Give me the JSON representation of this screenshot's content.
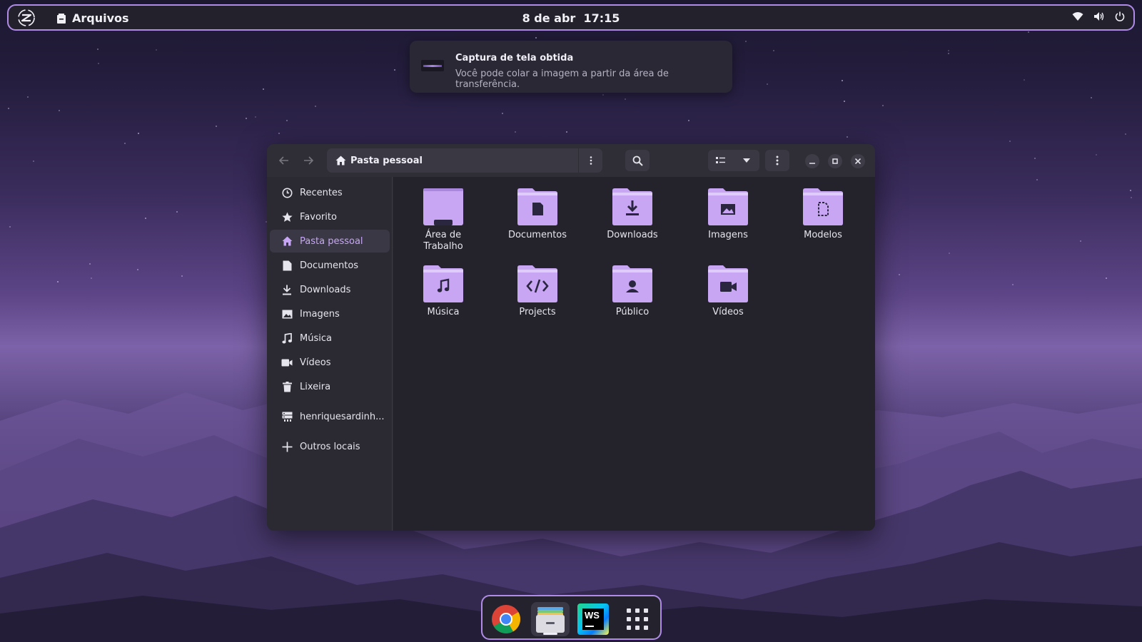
{
  "topbar": {
    "app_name": "Arquivos",
    "clock": "8 de abr  17:15",
    "icons": [
      "zorin-menu-icon",
      "wifi-icon",
      "volume-icon",
      "power-icon"
    ]
  },
  "notification": {
    "title": "Captura de tela obtida",
    "body": "Você pode colar a imagem a partir da área de transferência."
  },
  "window": {
    "path_label": "Pasta pessoal",
    "sidebar": [
      {
        "label": "Recentes",
        "icon": "clock-icon"
      },
      {
        "label": "Favorito",
        "icon": "star-icon"
      },
      {
        "label": "Pasta pessoal",
        "icon": "home-icon",
        "active": true
      },
      {
        "label": "Documentos",
        "icon": "document-icon"
      },
      {
        "label": "Downloads",
        "icon": "download-icon"
      },
      {
        "label": "Imagens",
        "icon": "image-icon"
      },
      {
        "label": "Música",
        "icon": "music-icon"
      },
      {
        "label": "Vídeos",
        "icon": "video-icon"
      },
      {
        "label": "Lixeira",
        "icon": "trash-icon"
      },
      {
        "label": "henriquesardinh...",
        "icon": "network-drive-icon"
      },
      {
        "label": "Outros locais",
        "icon": "plus-icon"
      }
    ],
    "files": [
      {
        "name": "Área de\nTrabalho",
        "icon": "desktop-folder-icon"
      },
      {
        "name": "Documentos",
        "icon": "documents-folder-icon"
      },
      {
        "name": "Downloads",
        "icon": "downloads-folder-icon"
      },
      {
        "name": "Imagens",
        "icon": "pictures-folder-icon"
      },
      {
        "name": "Modelos",
        "icon": "templates-folder-icon"
      },
      {
        "name": "Música",
        "icon": "music-folder-icon"
      },
      {
        "name": "Projects",
        "icon": "code-folder-icon"
      },
      {
        "name": "Público",
        "icon": "public-folder-icon"
      },
      {
        "name": "Vídeos",
        "icon": "videos-folder-icon"
      }
    ]
  },
  "dock": {
    "apps": [
      "chrome-icon",
      "files-icon",
      "webstorm-icon",
      "app-grid-icon"
    ],
    "webstorm_label": "WS"
  },
  "colors": {
    "accent": "#b08ce8",
    "folder": "#c8a6f4",
    "folder_dark": "#a987dd",
    "active_text": "#c7a6f5"
  }
}
